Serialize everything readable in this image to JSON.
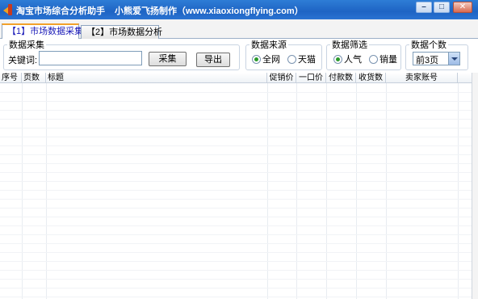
{
  "window": {
    "title": "淘宝市场综合分析助手",
    "subtitle": "小熊爱飞扬制作（www.xiaoxiongflying.com）",
    "min_glyph": "–",
    "max_glyph": "□",
    "close_glyph": "✕"
  },
  "tabs": [
    {
      "label": "【1】市场数据采集",
      "active": true
    },
    {
      "label": "【2】市场数据分析",
      "active": false
    }
  ],
  "collect_group": {
    "legend": "数据采集",
    "keyword_label": "关键词:",
    "keyword_value": "",
    "collect_button": "采集",
    "export_button": "导出"
  },
  "source_group": {
    "legend": "数据来源",
    "options": [
      {
        "label": "全网",
        "selected": true
      },
      {
        "label": "天猫",
        "selected": false
      }
    ]
  },
  "filter_group": {
    "legend": "数据筛选",
    "options": [
      {
        "label": "人气",
        "selected": true
      },
      {
        "label": "销量",
        "selected": false
      }
    ]
  },
  "count_group": {
    "legend": "数据个数",
    "selected": "前3页"
  },
  "table": {
    "columns": [
      "序号",
      "页数",
      "标题",
      "促销价",
      "一口价",
      "付款数",
      "收货数",
      "卖家账号"
    ]
  },
  "colors": {
    "titlebar": "#1e64c4",
    "tab_active_text": "#1a1ab8",
    "tab_active_accent": "#f2a12a"
  }
}
